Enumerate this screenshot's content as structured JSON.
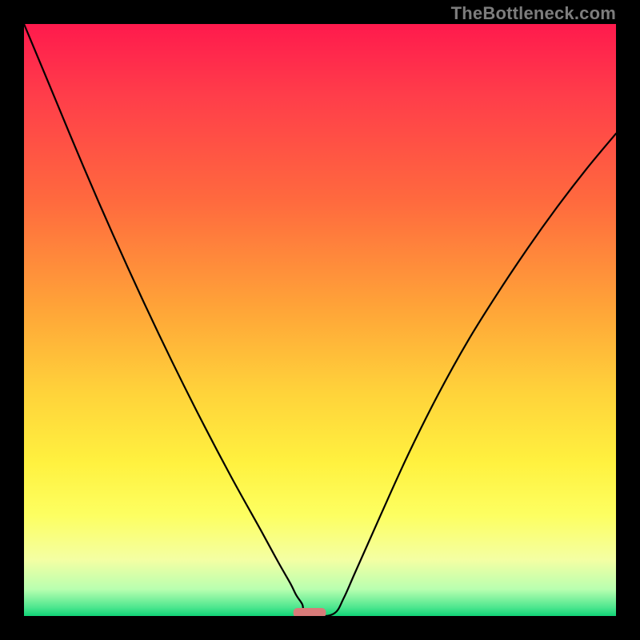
{
  "watermark": "TheBottleneck.com",
  "chart_data": {
    "type": "line",
    "title": "",
    "xlabel": "",
    "ylabel": "",
    "xlim": [
      0,
      1
    ],
    "ylim": [
      0,
      1
    ],
    "series": [
      {
        "name": "curve",
        "x": [
          0.0,
          0.05,
          0.1,
          0.15,
          0.2,
          0.25,
          0.3,
          0.35,
          0.4,
          0.43,
          0.45,
          0.46,
          0.47,
          0.475,
          0.5,
          0.525,
          0.54,
          0.56,
          0.6,
          0.65,
          0.7,
          0.75,
          0.8,
          0.85,
          0.9,
          0.95,
          1.0
        ],
        "y": [
          1.0,
          0.88,
          0.76,
          0.645,
          0.535,
          0.43,
          0.33,
          0.235,
          0.145,
          0.09,
          0.055,
          0.035,
          0.02,
          0.005,
          0.0,
          0.005,
          0.03,
          0.075,
          0.165,
          0.275,
          0.375,
          0.465,
          0.545,
          0.62,
          0.69,
          0.755,
          0.815
        ]
      }
    ],
    "marker": {
      "x_range": [
        0.455,
        0.51
      ],
      "y": 0.0
    },
    "gradient_stops": [
      {
        "offset": 0.0,
        "color": "#ff1a4d"
      },
      {
        "offset": 0.12,
        "color": "#ff3d4a"
      },
      {
        "offset": 0.3,
        "color": "#ff6a3e"
      },
      {
        "offset": 0.48,
        "color": "#ffa438"
      },
      {
        "offset": 0.62,
        "color": "#ffd23a"
      },
      {
        "offset": 0.74,
        "color": "#fff13f"
      },
      {
        "offset": 0.83,
        "color": "#fdff61"
      },
      {
        "offset": 0.905,
        "color": "#f4ffa3"
      },
      {
        "offset": 0.955,
        "color": "#b8ffb0"
      },
      {
        "offset": 0.985,
        "color": "#4fe78f"
      },
      {
        "offset": 1.0,
        "color": "#11d477"
      }
    ]
  }
}
